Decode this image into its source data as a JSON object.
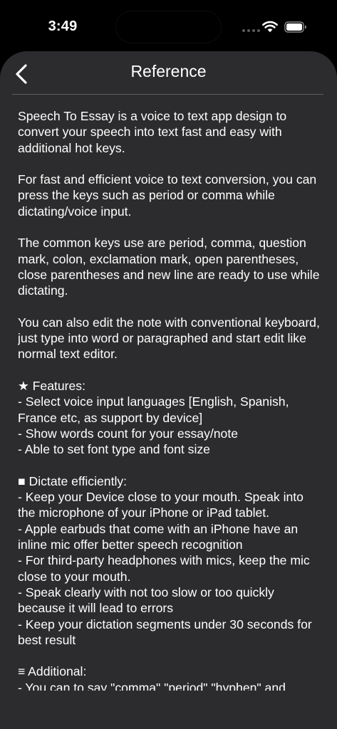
{
  "status_bar": {
    "time": "3:49"
  },
  "nav": {
    "back_icon": "chevron-left-icon",
    "title": "Reference"
  },
  "colors": {
    "background": "#000000",
    "sheet": "#2c2c2e",
    "text": "#ffffff",
    "divider": "#5e5e62"
  },
  "content": {
    "text": "Speech To Essay is a voice to text app design to convert your speech into text fast and easy with additional hot keys.\n\nFor fast and efficient voice to text conversion, you can press the keys such as period or comma while dictating/voice input.\n\nThe common keys use are period, comma, question mark, colon, exclamation mark, open parentheses, close parentheses and new line are ready to use while dictating.\n\nYou can also edit the note with conventional keyboard, just type into word or paragraphed and start edit like normal text editor.\n\n★ Features:\n- Select voice input languages [English, Spanish, France etc, as support by device]\n- Show words count for your essay/note\n- Able to set font type and font size\n\n■ Dictate efficiently:\n- Keep your Device close to your mouth. Speak into the microphone of your iPhone or iPad tablet.\n- Apple earbuds that come with an iPhone have an inline mic offer better speech recognition\n- For third-party headphones with mics, keep the mic close to your mouth.\n- Speak clearly with not too slow or too quickly because it will lead to errors\n- Keep your dictation segments under 30 seconds for best result\n\n≡ Additional:\n- You can to say \"comma\" \"period\" \"hyphen\" and"
  }
}
